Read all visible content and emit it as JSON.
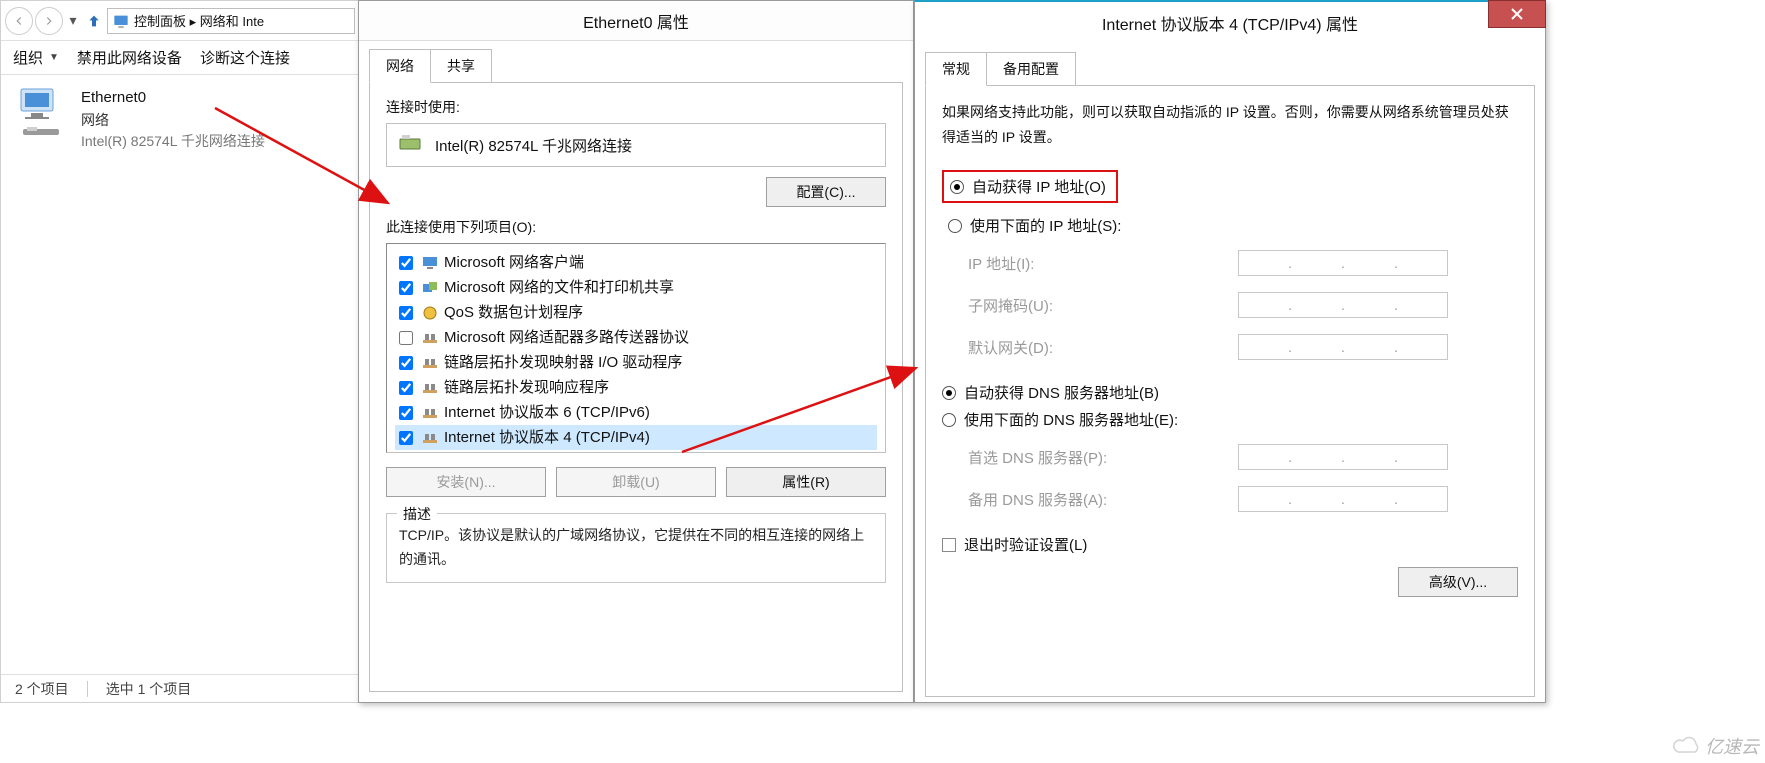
{
  "explorer": {
    "breadcrumb": "控制面板 ▸ 网络和 Inte",
    "toolbar": {
      "organize": "组织",
      "disable": "禁用此网络设备",
      "diagnose": "诊断这个连接"
    },
    "adapter": {
      "name": "Ethernet0",
      "network": "网络",
      "device": "Intel(R) 82574L 千兆网络连接"
    },
    "status": {
      "count": "2 个项目",
      "selected": "选中 1 个项目"
    }
  },
  "ethernet_dialog": {
    "title": "Ethernet0 属性",
    "tabs": {
      "network": "网络",
      "sharing": "共享"
    },
    "connect_using_label": "连接时使用:",
    "connect_using_value": "Intel(R) 82574L 千兆网络连接",
    "configure_btn": "配置(C)...",
    "items_label": "此连接使用下列项目(O):",
    "items": [
      {
        "checked": true,
        "label": "Microsoft 网络客户端",
        "icon": "client"
      },
      {
        "checked": true,
        "label": "Microsoft 网络的文件和打印机共享",
        "icon": "share"
      },
      {
        "checked": true,
        "label": "QoS 数据包计划程序",
        "icon": "qos"
      },
      {
        "checked": false,
        "label": "Microsoft 网络适配器多路传送器协议",
        "icon": "proto"
      },
      {
        "checked": true,
        "label": "链路层拓扑发现映射器 I/O 驱动程序",
        "icon": "proto"
      },
      {
        "checked": true,
        "label": "链路层拓扑发现响应程序",
        "icon": "proto"
      },
      {
        "checked": true,
        "label": "Internet 协议版本 6 (TCP/IPv6)",
        "icon": "proto"
      },
      {
        "checked": true,
        "label": "Internet 协议版本 4 (TCP/IPv4)",
        "icon": "proto",
        "selected": true
      }
    ],
    "buttons": {
      "install": "安装(N)...",
      "uninstall": "卸载(U)",
      "properties": "属性(R)"
    },
    "desc_legend": "描述",
    "desc_text": "TCP/IP。该协议是默认的广域网络协议，它提供在不同的相互连接的网络上的通讯。"
  },
  "ipv4_dialog": {
    "title": "Internet 协议版本 4 (TCP/IPv4) 属性",
    "tabs": {
      "general": "常规",
      "alternate": "备用配置"
    },
    "info": "如果网络支持此功能，则可以获取自动指派的 IP 设置。否则，你需要从网络系统管理员处获得适当的 IP 设置。",
    "ip_auto": "自动获得 IP 地址(O)",
    "ip_manual": "使用下面的 IP 地址(S):",
    "ip_label": "IP 地址(I):",
    "mask_label": "子网掩码(U):",
    "gateway_label": "默认网关(D):",
    "dns_auto": "自动获得 DNS 服务器地址(B)",
    "dns_manual": "使用下面的 DNS 服务器地址(E):",
    "dns1_label": "首选 DNS 服务器(P):",
    "dns2_label": "备用 DNS 服务器(A):",
    "validate": "退出时验证设置(L)",
    "advanced": "高级(V)..."
  },
  "watermark": "亿速云"
}
